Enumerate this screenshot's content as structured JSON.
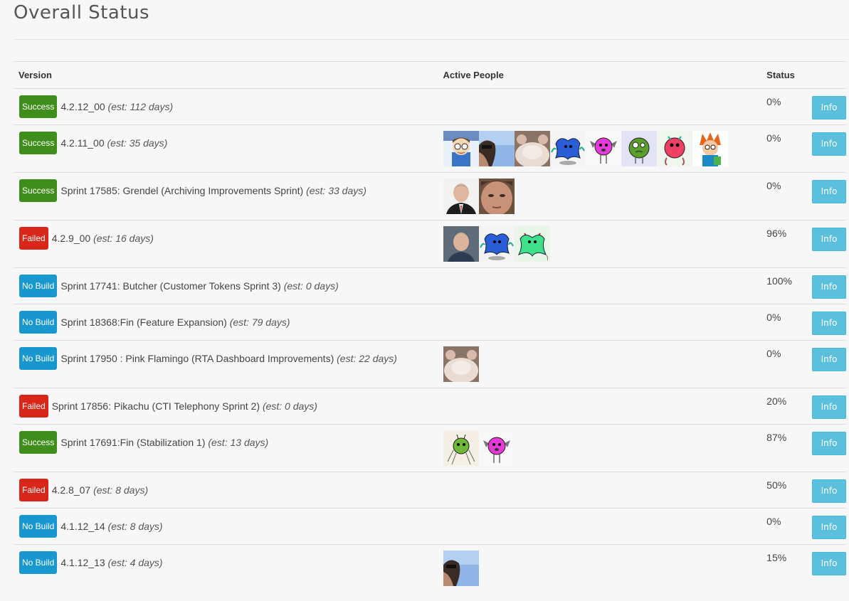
{
  "page": {
    "title": "Overall Status"
  },
  "table": {
    "headers": {
      "version": "Version",
      "people": "Active People",
      "status": "Status"
    },
    "rows": [
      {
        "badge": "Success",
        "badge_type": "success",
        "name": "4.2.12_00",
        "est": "(est: 112 days)",
        "status": "0%",
        "info": "Info",
        "people": []
      },
      {
        "badge": "Success",
        "badge_type": "success",
        "name": "4.2.11_00",
        "est": "(est: 35 days)",
        "status": "0%",
        "info": "Info",
        "people": [
          "cartoon-boy-avatar",
          "person-sunglasses-avatar",
          "hamster-avatar",
          "blue-monster-avatar",
          "pink-bat-monster-avatar",
          "green-monster-avatar",
          "pink-monster-avatar",
          "redhead-cartoon-avatar"
        ]
      },
      {
        "badge": "Success",
        "badge_type": "success",
        "name": "Sprint 17585: Grendel (Archiving Improvements Sprint)",
        "est": "(est: 33 days)",
        "status": "0%",
        "info": "Info",
        "people": [
          "man-suit-avatar",
          "man-closeup-avatar"
        ]
      },
      {
        "badge": "Failed",
        "badge_type": "failed",
        "name": "4.2.9_00",
        "est": "(est: 16 days)",
        "status": "96%",
        "info": "Info",
        "people": [
          "man-portrait-avatar",
          "blue-monster-avatar",
          "green-horned-monster-avatar"
        ]
      },
      {
        "badge": "No Build",
        "badge_type": "nobuild",
        "name": "Sprint 17741: Butcher (Customer Tokens Sprint 3)",
        "est": "(est: 0 days)",
        "status": "100%",
        "info": "Info",
        "people": []
      },
      {
        "badge": "No Build",
        "badge_type": "nobuild",
        "name": "Sprint 18368:Fin (Feature Expansion)",
        "est": "(est: 79 days)",
        "status": "0%",
        "info": "Info",
        "people": []
      },
      {
        "badge": "No Build",
        "badge_type": "nobuild",
        "name": "Sprint 17950 : Pink Flamingo (RTA Dashboard Improvements)",
        "est": "(est: 22 days)",
        "status": "0%",
        "info": "Info",
        "people": [
          "hamster-avatar"
        ]
      },
      {
        "badge": "Failed",
        "badge_type": "failed",
        "name": "Sprint 17856: Pikachu (CTI Telephony Sprint 2)",
        "est": "(est: 0 days)",
        "status": "20%",
        "info": "Info",
        "people": []
      },
      {
        "badge": "Success",
        "badge_type": "success",
        "name": "Sprint 17691:Fin (Stabilization 1)",
        "est": "(est: 13 days)",
        "status": "87%",
        "info": "Info",
        "people": [
          "green-spider-monster-avatar",
          "pink-bat-monster-avatar"
        ]
      },
      {
        "badge": "Failed",
        "badge_type": "failed",
        "name": "4.2.8_07",
        "est": "(est: 8 days)",
        "status": "50%",
        "info": "Info",
        "people": []
      },
      {
        "badge": "No Build",
        "badge_type": "nobuild",
        "name": "4.1.12_14",
        "est": "(est: 8 days)",
        "status": "0%",
        "info": "Info",
        "people": []
      },
      {
        "badge": "No Build",
        "badge_type": "nobuild",
        "name": "4.1.12_13",
        "est": "(est: 4 days)",
        "status": "15%",
        "info": "Info",
        "people": [
          "person-sunglasses-avatar"
        ]
      }
    ]
  },
  "colors": {
    "success": "#3f8e1c",
    "failed": "#d9261a",
    "nobuild": "#1998cf",
    "info_button": "#5bc0de"
  }
}
